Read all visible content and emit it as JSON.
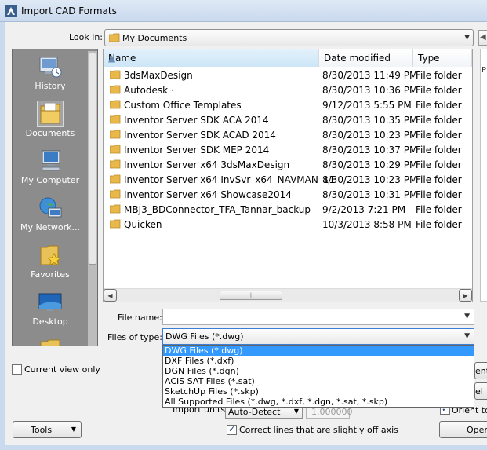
{
  "window": {
    "title": "Import CAD Formats"
  },
  "look_in": {
    "label": "Look in:",
    "value": "My Documents"
  },
  "places": [
    {
      "label": "History",
      "icon": "history-icon"
    },
    {
      "label": "Documents",
      "icon": "documents-icon"
    },
    {
      "label": "My Computer",
      "icon": "computer-icon"
    },
    {
      "label": "My Network...",
      "icon": "network-icon"
    },
    {
      "label": "Favorites",
      "icon": "favorites-icon"
    },
    {
      "label": "Desktop",
      "icon": "desktop-icon"
    }
  ],
  "columns": {
    "name": "Name",
    "date": "Date modified",
    "type": "Type"
  },
  "files": [
    {
      "name": "3dsMaxDesign",
      "date": "8/30/2013 11:49 PM",
      "type": "File folder"
    },
    {
      "name": "Autodesk ·",
      "date": "8/30/2013 10:36 PM",
      "type": "File folder"
    },
    {
      "name": "Custom Office Templates",
      "date": "9/12/2013 5:55 PM",
      "type": "File folder"
    },
    {
      "name": "Inventor Server SDK ACA 2014",
      "date": "8/30/2013 10:35 PM",
      "type": "File folder"
    },
    {
      "name": "Inventor Server SDK ACAD 2014",
      "date": "8/30/2013 10:23 PM",
      "type": "File folder"
    },
    {
      "name": "Inventor Server SDK MEP 2014",
      "date": "8/30/2013 10:37 PM",
      "type": "File folder"
    },
    {
      "name": "Inventor Server x64 3dsMaxDesign",
      "date": "8/30/2013 10:29 PM",
      "type": "File folder"
    },
    {
      "name": "Inventor Server x64 InvSvr_x64_NAVMAN_11",
      "date": "8/30/2013 10:23 PM",
      "type": "File folder"
    },
    {
      "name": "Inventor Server x64 Showcase2014",
      "date": "8/30/2013 10:31 PM",
      "type": "File folder"
    },
    {
      "name": "MBJ3_BDConnector_TFA_Tannar_backup",
      "date": "9/2/2013 7:21 PM",
      "type": "File folder"
    },
    {
      "name": "Quicken",
      "date": "10/3/2013 8:58 PM",
      "type": "File folder"
    }
  ],
  "file_name": {
    "label": "File name:",
    "value": ""
  },
  "file_type": {
    "label": "Files of type:",
    "value": "DWG Files  (*.dwg)",
    "options": [
      "DWG Files  (*.dwg)",
      "DXF Files  (*.dxf)",
      "DGN Files  (*.dgn)",
      "ACIS SAT Files  (*.sat)",
      "SketchUp Files  (*.skp)",
      "All Supported Files  (*.dwg, *.dxf, *.dgn, *.sat, *.skp)"
    ],
    "selected_index": 0
  },
  "current_view_only": {
    "label": "Current view only",
    "checked": false
  },
  "import_units": {
    "label": "Import units:",
    "value": "Auto-Detect",
    "scale": "1.000000"
  },
  "orient": {
    "label": "Orient to",
    "checked": true
  },
  "correct_lines": {
    "label": "Correct lines that are slightly off axis",
    "checked": true
  },
  "buttons": {
    "tools": "Tools",
    "open": "Open",
    "side1": "ente",
    "side2": "el"
  },
  "preview_label": "P",
  "colors": {
    "selection": "#3399ff",
    "places_bg": "#8c8c8c",
    "folder": "#e8b94a"
  }
}
